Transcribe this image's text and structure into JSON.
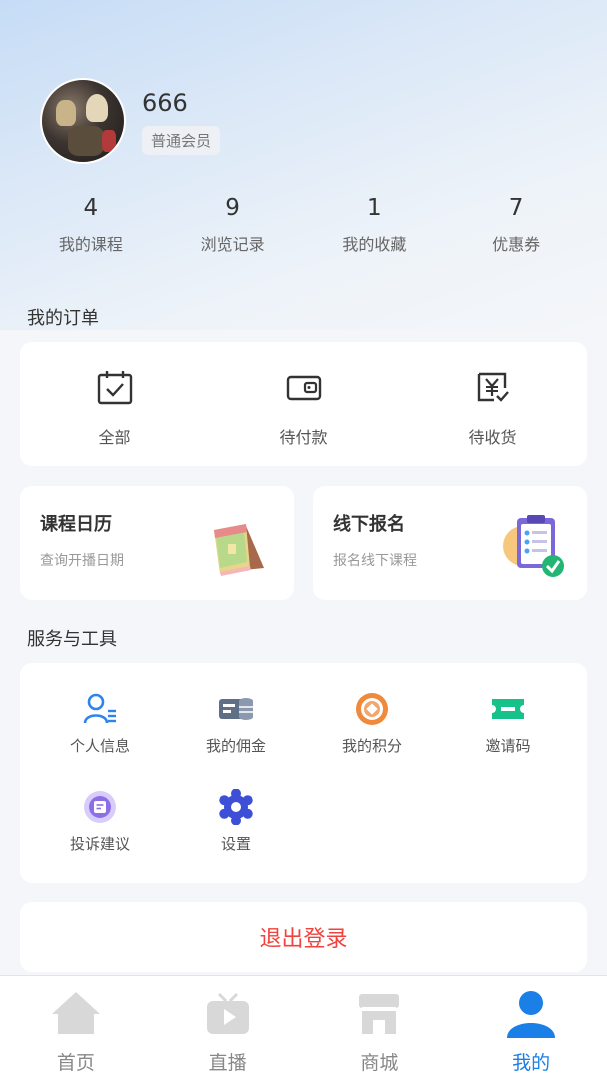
{
  "profile": {
    "username": "666",
    "member_level": "普通会员"
  },
  "stats": [
    {
      "value": "4",
      "label": "我的课程"
    },
    {
      "value": "9",
      "label": "浏览记录"
    },
    {
      "value": "1",
      "label": "我的收藏"
    },
    {
      "value": "7",
      "label": "优惠券"
    }
  ],
  "orders": {
    "title": "我的订单",
    "items": [
      {
        "label": "全部",
        "icon": "calendar-check-icon"
      },
      {
        "label": "待付款",
        "icon": "wallet-icon"
      },
      {
        "label": "待收货",
        "icon": "yen-receipt-icon"
      }
    ]
  },
  "features": [
    {
      "title": "课程日历",
      "subtitle": "查询开播日期",
      "icon": "desk-calendar-illustration"
    },
    {
      "title": "线下报名",
      "subtitle": "报名线下课程",
      "icon": "clipboard-check-illustration"
    }
  ],
  "tools": {
    "title": "服务与工具",
    "items": [
      {
        "label": "个人信息",
        "icon": "user-profile-icon"
      },
      {
        "label": "我的佣金",
        "icon": "commission-icon"
      },
      {
        "label": "我的积分",
        "icon": "points-coin-icon"
      },
      {
        "label": "邀请码",
        "icon": "ticket-icon"
      },
      {
        "label": "投诉建议",
        "icon": "feedback-icon"
      },
      {
        "label": "设置",
        "icon": "gear-icon"
      }
    ]
  },
  "logout_label": "退出登录",
  "tabbar": [
    {
      "label": "首页",
      "icon": "home-icon"
    },
    {
      "label": "直播",
      "icon": "tv-icon"
    },
    {
      "label": "商城",
      "icon": "store-icon"
    },
    {
      "label": "我的",
      "icon": "user-icon",
      "active": true
    }
  ],
  "colors": {
    "accent": "#1a7fe6",
    "logout": "#f0433d",
    "tab_inactive": "#888888",
    "background": "#f4f6f9"
  }
}
